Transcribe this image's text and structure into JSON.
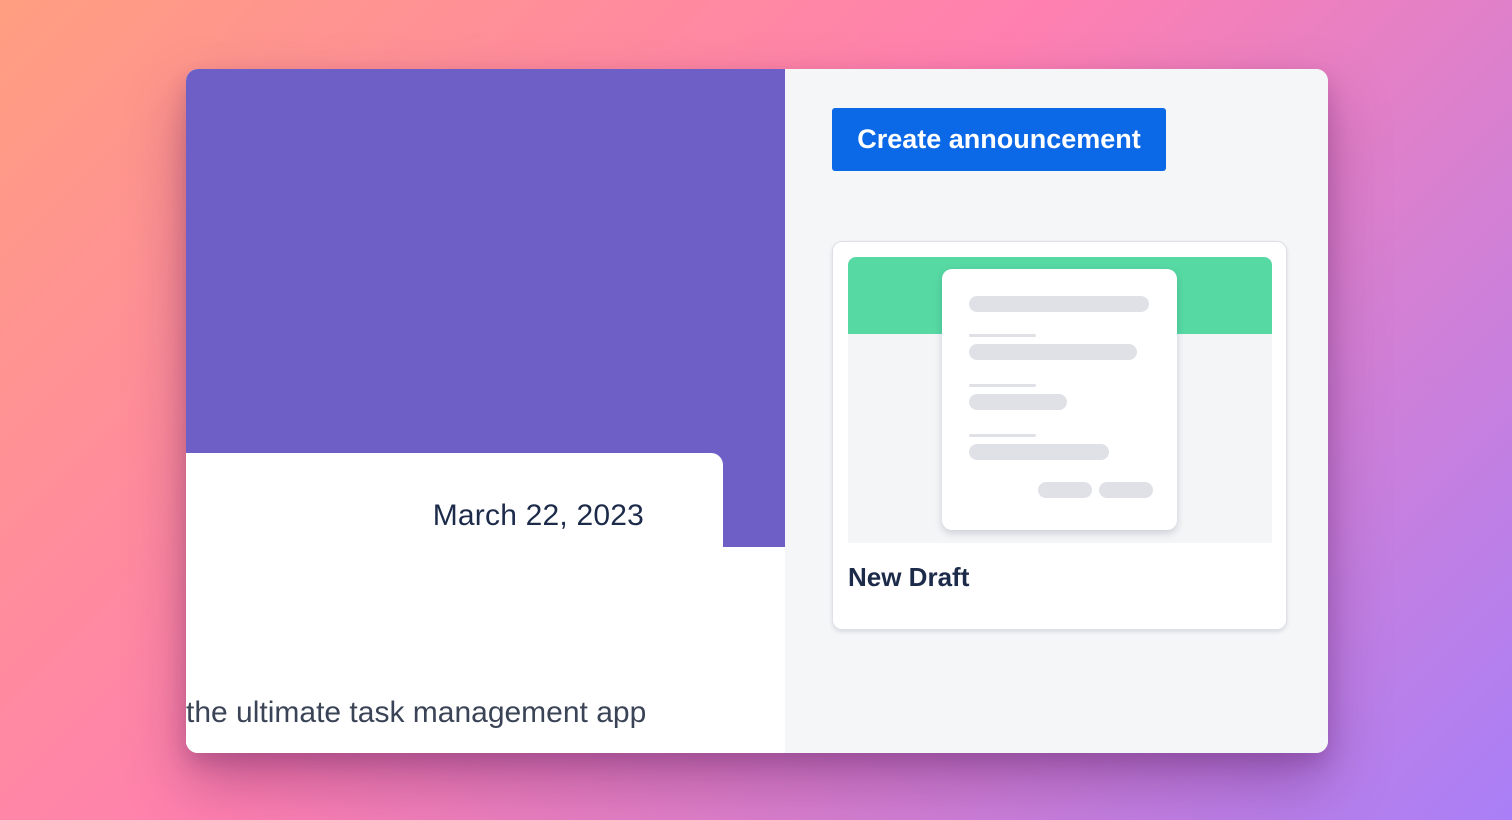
{
  "announcement": {
    "date": "March 22, 2023",
    "body_text": "the ultimate task management app"
  },
  "sidebar": {
    "create_button_label": "Create announcement",
    "drafts": [
      {
        "title": "New Draft"
      }
    ]
  },
  "colors": {
    "hero_background": "#6e5fc6",
    "primary_button": "#0b68e6",
    "draft_band": "#57d9a3"
  }
}
